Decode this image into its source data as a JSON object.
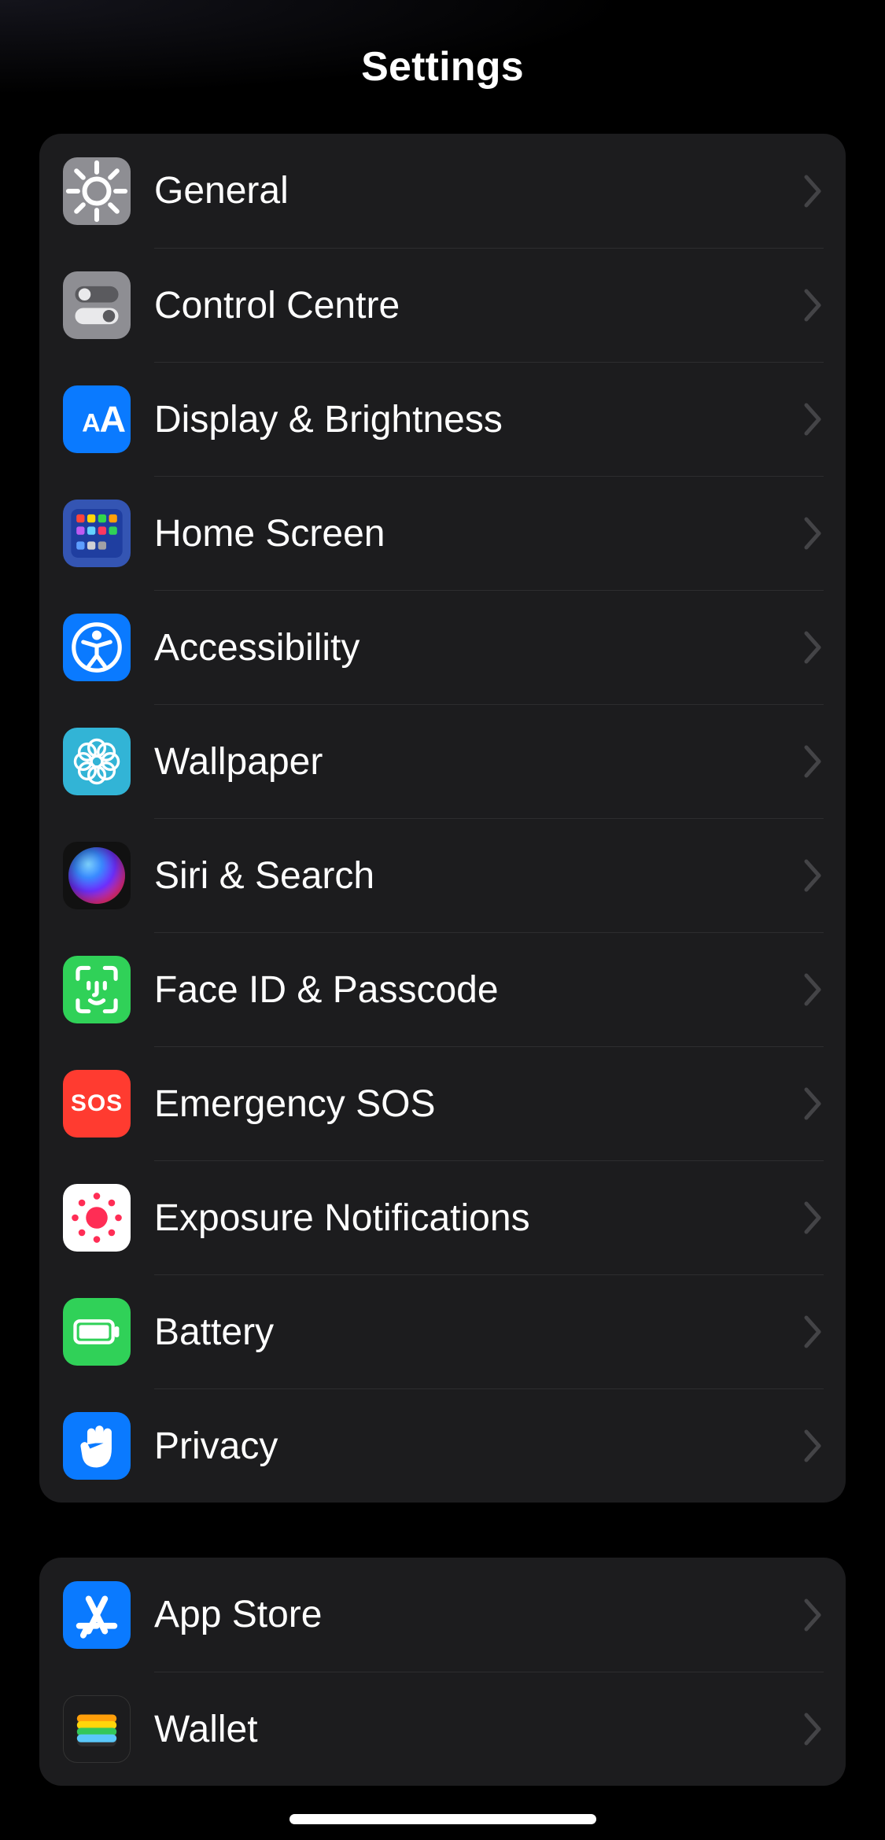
{
  "header": {
    "title": "Settings"
  },
  "groups": [
    {
      "items": [
        {
          "id": "general",
          "label": "General"
        },
        {
          "id": "control",
          "label": "Control Centre"
        },
        {
          "id": "display",
          "label": "Display & Brightness"
        },
        {
          "id": "home",
          "label": "Home Screen"
        },
        {
          "id": "access",
          "label": "Accessibility"
        },
        {
          "id": "wallpaper",
          "label": "Wallpaper"
        },
        {
          "id": "siri",
          "label": "Siri & Search"
        },
        {
          "id": "faceid",
          "label": "Face ID & Passcode"
        },
        {
          "id": "sos",
          "label": "Emergency SOS"
        },
        {
          "id": "exposure",
          "label": "Exposure Notifications"
        },
        {
          "id": "battery",
          "label": "Battery"
        },
        {
          "id": "privacy",
          "label": "Privacy"
        }
      ]
    },
    {
      "items": [
        {
          "id": "appstore",
          "label": "App Store"
        },
        {
          "id": "wallet",
          "label": "Wallet"
        }
      ]
    }
  ],
  "icons": {
    "general": "gear-icon",
    "control": "toggles-icon",
    "display": "text-size-icon",
    "home": "app-grid-icon",
    "access": "accessibility-icon",
    "wallpaper": "flower-icon",
    "siri": "siri-orb-icon",
    "faceid": "face-id-icon",
    "sos": "sos-icon",
    "exposure": "exposure-dots-icon",
    "battery": "battery-icon",
    "privacy": "hand-icon",
    "appstore": "app-store-icon",
    "wallet": "wallet-icon"
  },
  "sosText": "SOS"
}
